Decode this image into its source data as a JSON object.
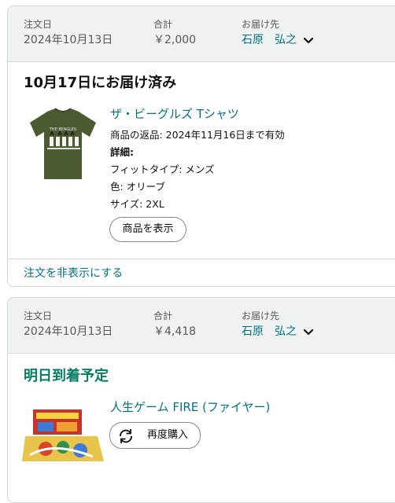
{
  "orders": [
    {
      "header": {
        "order_date_label": "注文日",
        "order_date": "2024年10月13日",
        "total_label": "合計",
        "total": "￥2,000",
        "ship_to_label": "お届け先",
        "ship_to": "石原　弘之"
      },
      "status": "10月17日にお届け済み",
      "item": {
        "title": "ザ・ビーグルズ Tシャツ",
        "return_info": "商品の返品: 2024年11月16日まで有効",
        "details_label": "詳細:",
        "fit": "フィットタイプ: メンズ",
        "color": "色: オリーブ",
        "size": "サイズ: 2XL",
        "view_button": "商品を表示",
        "shirt_print": "THE BEAGLES"
      },
      "hide_order_link": "注文を非表示にする"
    },
    {
      "header": {
        "order_date_label": "注文日",
        "order_date": "2024年10月13日",
        "total_label": "合計",
        "total": "￥4,418",
        "ship_to_label": "お届け先",
        "ship_to": "石原　弘之"
      },
      "status": "明日到着予定",
      "item": {
        "title": "人生ゲーム FIRE (ファイヤー)",
        "buy_again_button": "再度購入"
      }
    }
  ],
  "colors": {
    "link": "#007185",
    "status_green": "#067d62",
    "header_bg": "#f0f2f2",
    "border": "#d5d9d9",
    "shirt": "#4c5a32"
  },
  "icons": {
    "chevron": "chevron-down-icon",
    "reorder": "reorder-icon"
  }
}
